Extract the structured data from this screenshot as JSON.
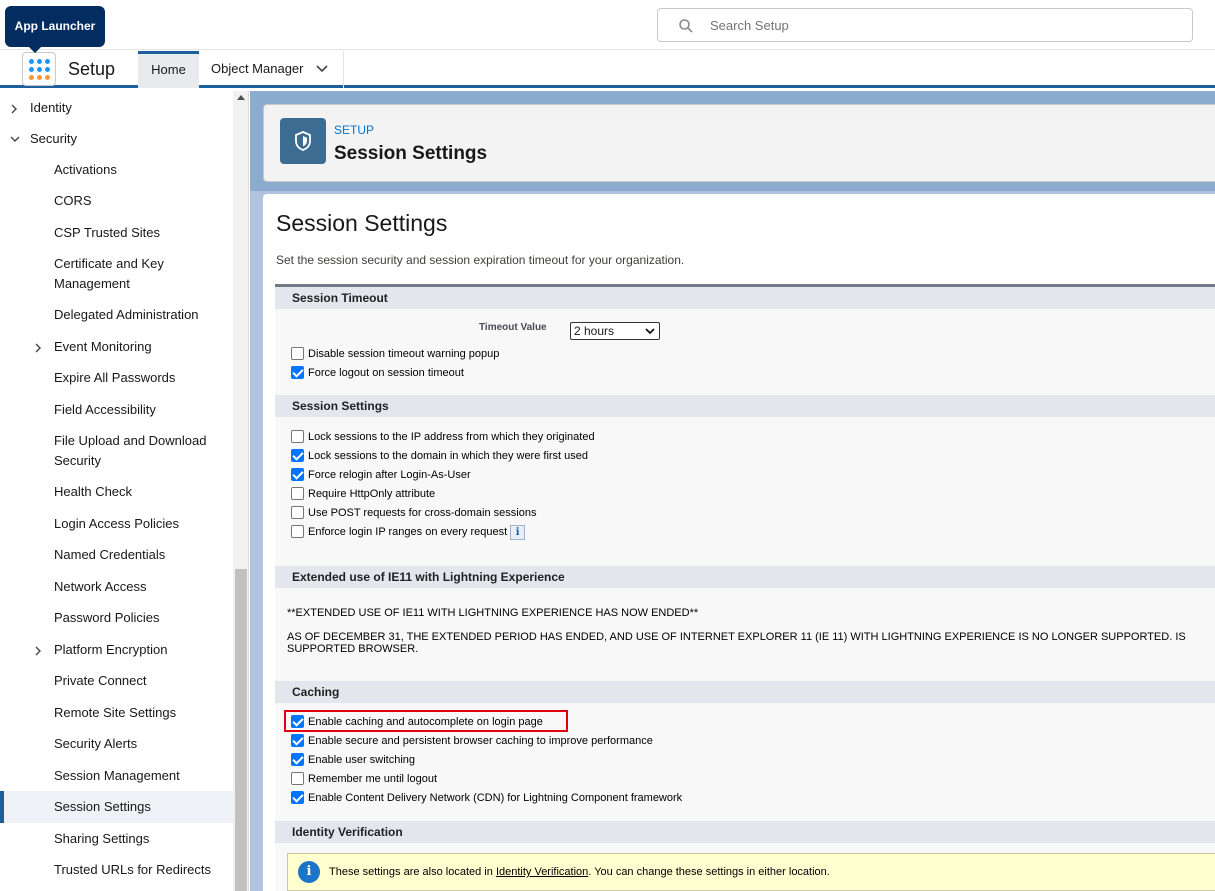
{
  "header": {
    "tooltip": "App Launcher",
    "search_placeholder": "Search Setup",
    "app_name": "Setup",
    "tabs": {
      "home": "Home",
      "object_manager": "Object Manager"
    }
  },
  "sidebar": {
    "identity": "Identity",
    "security": "Security",
    "items": [
      "Activations",
      "CORS",
      "CSP Trusted Sites",
      "Certificate and Key Management",
      "Delegated Administration",
      "Event Monitoring",
      "Expire All Passwords",
      "Field Accessibility",
      "File Upload and Download Security",
      "Health Check",
      "Login Access Policies",
      "Named Credentials",
      "Network Access",
      "Password Policies",
      "Platform Encryption",
      "Private Connect",
      "Remote Site Settings",
      "Security Alerts",
      "Session Management",
      "Session Settings",
      "Sharing Settings",
      "Trusted URLs for Redirects"
    ],
    "active": "Session Settings"
  },
  "page_header": {
    "eyebrow": "SETUP",
    "title": "Session Settings"
  },
  "page": {
    "title": "Session Settings",
    "description": "Set the session security and session expiration timeout for your organization."
  },
  "session_timeout": {
    "heading": "Session Timeout",
    "timeout_label": "Timeout Value",
    "timeout_value": "2 hours",
    "options": [
      {
        "label": "Disable session timeout warning popup",
        "checked": false
      },
      {
        "label": "Force logout on session timeout",
        "checked": true
      }
    ]
  },
  "session_settings": {
    "heading": "Session Settings",
    "options": [
      {
        "label": "Lock sessions to the IP address from which they originated",
        "checked": false
      },
      {
        "label": "Lock sessions to the domain in which they were first used",
        "checked": true
      },
      {
        "label": "Force relogin after Login-As-User",
        "checked": true
      },
      {
        "label": "Require HttpOnly attribute",
        "checked": false
      },
      {
        "label": "Use POST requests for cross-domain sessions",
        "checked": false
      },
      {
        "label": "Enforce login IP ranges on every request",
        "checked": false
      }
    ],
    "info_glyph": "i"
  },
  "ie11": {
    "heading": "Extended use of IE11 with Lightning Experience",
    "line1": "**EXTENDED USE OF IE11 WITH LIGHTNING EXPERIENCE HAS NOW ENDED**",
    "line2a": "AS OF DECEMBER 31, THE EXTENDED PERIOD HAS ENDED, AND USE OF INTERNET EXPLORER 11 (IE 11) WITH LIGHTNING EXPERIENCE IS NO LONGER SUPPORTED. IS",
    "line2b": "SUPPORTED BROWSER."
  },
  "caching": {
    "heading": "Caching",
    "options": [
      {
        "label": "Enable caching and autocomplete on login page",
        "checked": true
      },
      {
        "label": "Enable secure and persistent browser caching to improve performance",
        "checked": true
      },
      {
        "label": "Enable user switching",
        "checked": true
      },
      {
        "label": "Remember me until logout",
        "checked": false
      },
      {
        "label": "Enable Content Delivery Network (CDN) for Lightning Component framework",
        "checked": true
      }
    ]
  },
  "identity_verification": {
    "heading": "Identity Verification",
    "notice_before": "These settings are also located in ",
    "notice_link": "Identity Verification",
    "notice_after": ". You can change these settings in either location.",
    "notice_glyph": "i"
  },
  "colors": {
    "brand": "#1b5f9e",
    "highlight": "#e1000f",
    "checkbox": "#0075ff"
  }
}
